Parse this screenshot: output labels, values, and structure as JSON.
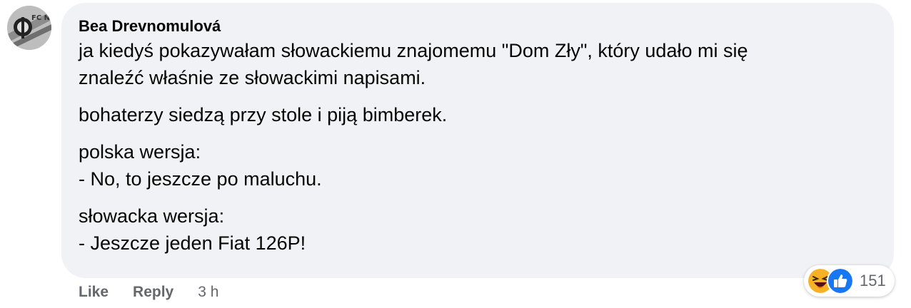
{
  "comment": {
    "author": "Bea Drevnomulová",
    "avatar_badge": "FC NZS",
    "paragraphs": [
      "ja kiedyś pokazywałam słowackiemu znajomemu \"Dom Zły\", który udało mi się\nznaleźć właśnie ze słowackimi napisami.",
      "bohaterzy siedzą przy stole i piją bimberek.",
      "polska wersja:\n- No, to jeszcze po maluchu.",
      "słowacka wersja:\n- Jeszcze jeden Fiat 126P!"
    ]
  },
  "reactions": {
    "icons": [
      "laughing-emoji-icon",
      "thumbs-up-like-icon"
    ],
    "count": "151"
  },
  "actions": {
    "like_label": "Like",
    "reply_label": "Reply",
    "timestamp": "3 h"
  },
  "colors": {
    "bubble_bg": "#f0f2f5",
    "text": "#050505",
    "secondary_text": "#65676b",
    "like_blue": "#1877f2",
    "haha_yellow": "#f7b125"
  }
}
